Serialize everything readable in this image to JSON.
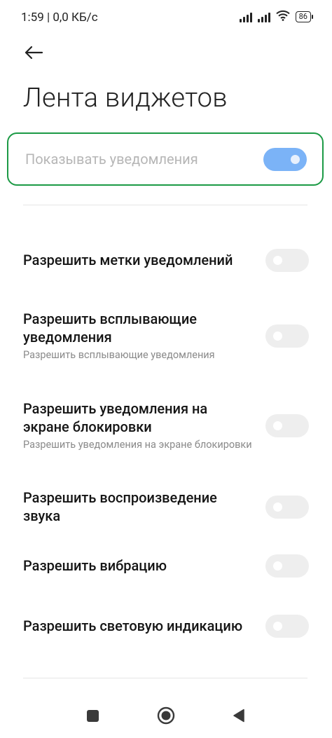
{
  "status_bar": {
    "time": "1:59 | 0,0 КБ/с",
    "battery": "86",
    "icons": [
      "signal-icon",
      "signal-icon",
      "wifi-icon",
      "battery-icon"
    ]
  },
  "header": {
    "back_icon": "arrow-left-icon",
    "title": "Лента виджетов"
  },
  "master_toggle": {
    "label": "Показывать уведомления",
    "enabled": true,
    "accent_color": "#7bb3f7",
    "highlight_color": "#1c9a45"
  },
  "settings": [
    {
      "title": "Разрешить метки уведомлений",
      "subtitle": "",
      "enabled": false
    },
    {
      "title": "Разрешить всплывающие уведомления",
      "subtitle": "Разрешить всплывающие уведомления",
      "enabled": false
    },
    {
      "title": "Разрешить уведомления на экране блокировки",
      "subtitle": "Разрешить уведомления на экране блокировки",
      "enabled": false
    },
    {
      "title": "Разрешить воспроизведение звука",
      "subtitle": "",
      "enabled": false
    },
    {
      "title": "Разрешить вибрацию",
      "subtitle": "",
      "enabled": false
    },
    {
      "title": "Разрешить световую индикацию",
      "subtitle": "",
      "enabled": false
    }
  ],
  "nav_bar": {
    "buttons": [
      "recents-square-icon",
      "home-circle-icon",
      "back-triangle-icon"
    ]
  }
}
